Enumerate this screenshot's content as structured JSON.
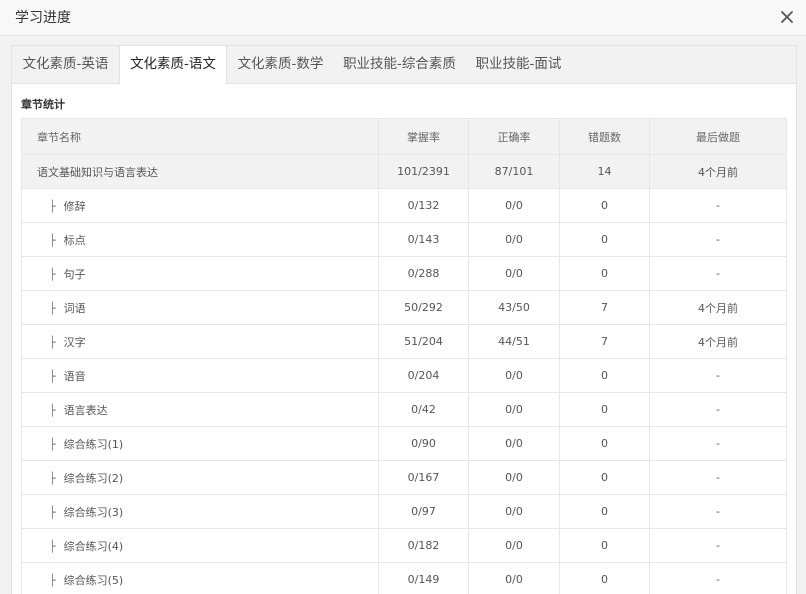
{
  "window": {
    "title": "学习进度"
  },
  "tabs": [
    {
      "label": "文化素质-英语",
      "active": false
    },
    {
      "label": "文化素质-语文",
      "active": true
    },
    {
      "label": "文化素质-数学",
      "active": false
    },
    {
      "label": "职业技能-综合素质",
      "active": false
    },
    {
      "label": "职业技能-面试",
      "active": false
    }
  ],
  "section": {
    "title": "章节统计"
  },
  "table": {
    "headers": [
      "章节名称",
      "掌握率",
      "正确率",
      "错题数",
      "最后做题"
    ],
    "tree_glyph": "├",
    "rows": [
      {
        "name": "语文基础知识与语言表达",
        "mastery": "101/2391",
        "accuracy": "87/101",
        "wrong": "14",
        "last": "4个月前",
        "level": 0
      },
      {
        "name": "修辞",
        "mastery": "0/132",
        "accuracy": "0/0",
        "wrong": "0",
        "last": "-",
        "level": 1
      },
      {
        "name": "标点",
        "mastery": "0/143",
        "accuracy": "0/0",
        "wrong": "0",
        "last": "-",
        "level": 1
      },
      {
        "name": "句子",
        "mastery": "0/288",
        "accuracy": "0/0",
        "wrong": "0",
        "last": "-",
        "level": 1
      },
      {
        "name": "词语",
        "mastery": "50/292",
        "accuracy": "43/50",
        "wrong": "7",
        "last": "4个月前",
        "level": 1
      },
      {
        "name": "汉字",
        "mastery": "51/204",
        "accuracy": "44/51",
        "wrong": "7",
        "last": "4个月前",
        "level": 1
      },
      {
        "name": "语音",
        "mastery": "0/204",
        "accuracy": "0/0",
        "wrong": "0",
        "last": "-",
        "level": 1
      },
      {
        "name": "语言表达",
        "mastery": "0/42",
        "accuracy": "0/0",
        "wrong": "0",
        "last": "-",
        "level": 1
      },
      {
        "name": "综合练习(1)",
        "mastery": "0/90",
        "accuracy": "0/0",
        "wrong": "0",
        "last": "-",
        "level": 1
      },
      {
        "name": "综合练习(2)",
        "mastery": "0/167",
        "accuracy": "0/0",
        "wrong": "0",
        "last": "-",
        "level": 1
      },
      {
        "name": "综合练习(3)",
        "mastery": "0/97",
        "accuracy": "0/0",
        "wrong": "0",
        "last": "-",
        "level": 1
      },
      {
        "name": "综合练习(4)",
        "mastery": "0/182",
        "accuracy": "0/0",
        "wrong": "0",
        "last": "-",
        "level": 1
      },
      {
        "name": "综合练习(5)",
        "mastery": "0/149",
        "accuracy": "0/0",
        "wrong": "0",
        "last": "-",
        "level": 1
      }
    ]
  }
}
